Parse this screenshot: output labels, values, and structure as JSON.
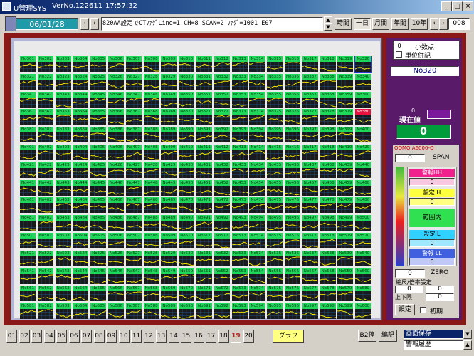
{
  "window": {
    "title": "U管理SYS",
    "version": "VerNo.122611",
    "time": "17:57:32"
  },
  "toolbar": {
    "date": "06/01/28",
    "message": "820AA設定でCTﾌｧｸﾞLine=1 CH=8 SCAN=2 ﾌｧｸﾞ=1001 E07",
    "period_buttons": [
      "時間",
      "一日",
      "月間",
      "年間",
      "10年"
    ],
    "active_period": "一日",
    "page": "1",
    "counter": "008"
  },
  "grid": {
    "rows": 15,
    "cols": 20,
    "start": 301,
    "selected": 380,
    "highlighted": 320,
    "label_prefix": "No",
    "colors": {
      "label": "#1ed85a",
      "selected": "#e8103c",
      "trace": "#f0e000",
      "grid_line": "#1f4f80"
    }
  },
  "side": {
    "decimal_label": "小数点",
    "decimal_value": "0",
    "unit_label": "単位併記",
    "selected_no": "No320",
    "current_label": "現在値",
    "current_small": "0",
    "current_value": "0",
    "device": "OOMO A6000-O",
    "span_value": "0",
    "span_label": "SPAN",
    "alarm_hh_label": "警報HH",
    "alarm_hh_value": "0",
    "setting_h_label": "設定 H",
    "setting_h_value": "0",
    "range_label": "範囲内",
    "setting_l_label": "設定 L",
    "setting_l_value": "0",
    "alarm_ll_label": "警報 LL",
    "alarm_ll_value": "0",
    "zero_value": "0",
    "zero_label": "ZERO",
    "scale_label": "縮尺/倍率設定",
    "scale_a": "0",
    "scale_b": "0",
    "limit_label": "上下限",
    "limit_value": "0",
    "set_button": "設定",
    "clear_label": "初期"
  },
  "bottom": {
    "channels": [
      "01",
      "02",
      "03",
      "04",
      "05",
      "06",
      "07",
      "08",
      "09",
      "10",
      "11",
      "12",
      "13",
      "14",
      "15",
      "16",
      "17",
      "18",
      "19",
      "20"
    ],
    "active_channel": "19",
    "graph_button": "グラフ",
    "stop_button": "B2停",
    "print_button": "編記",
    "save_option": "画面保存",
    "history_option": "警報履歴"
  }
}
